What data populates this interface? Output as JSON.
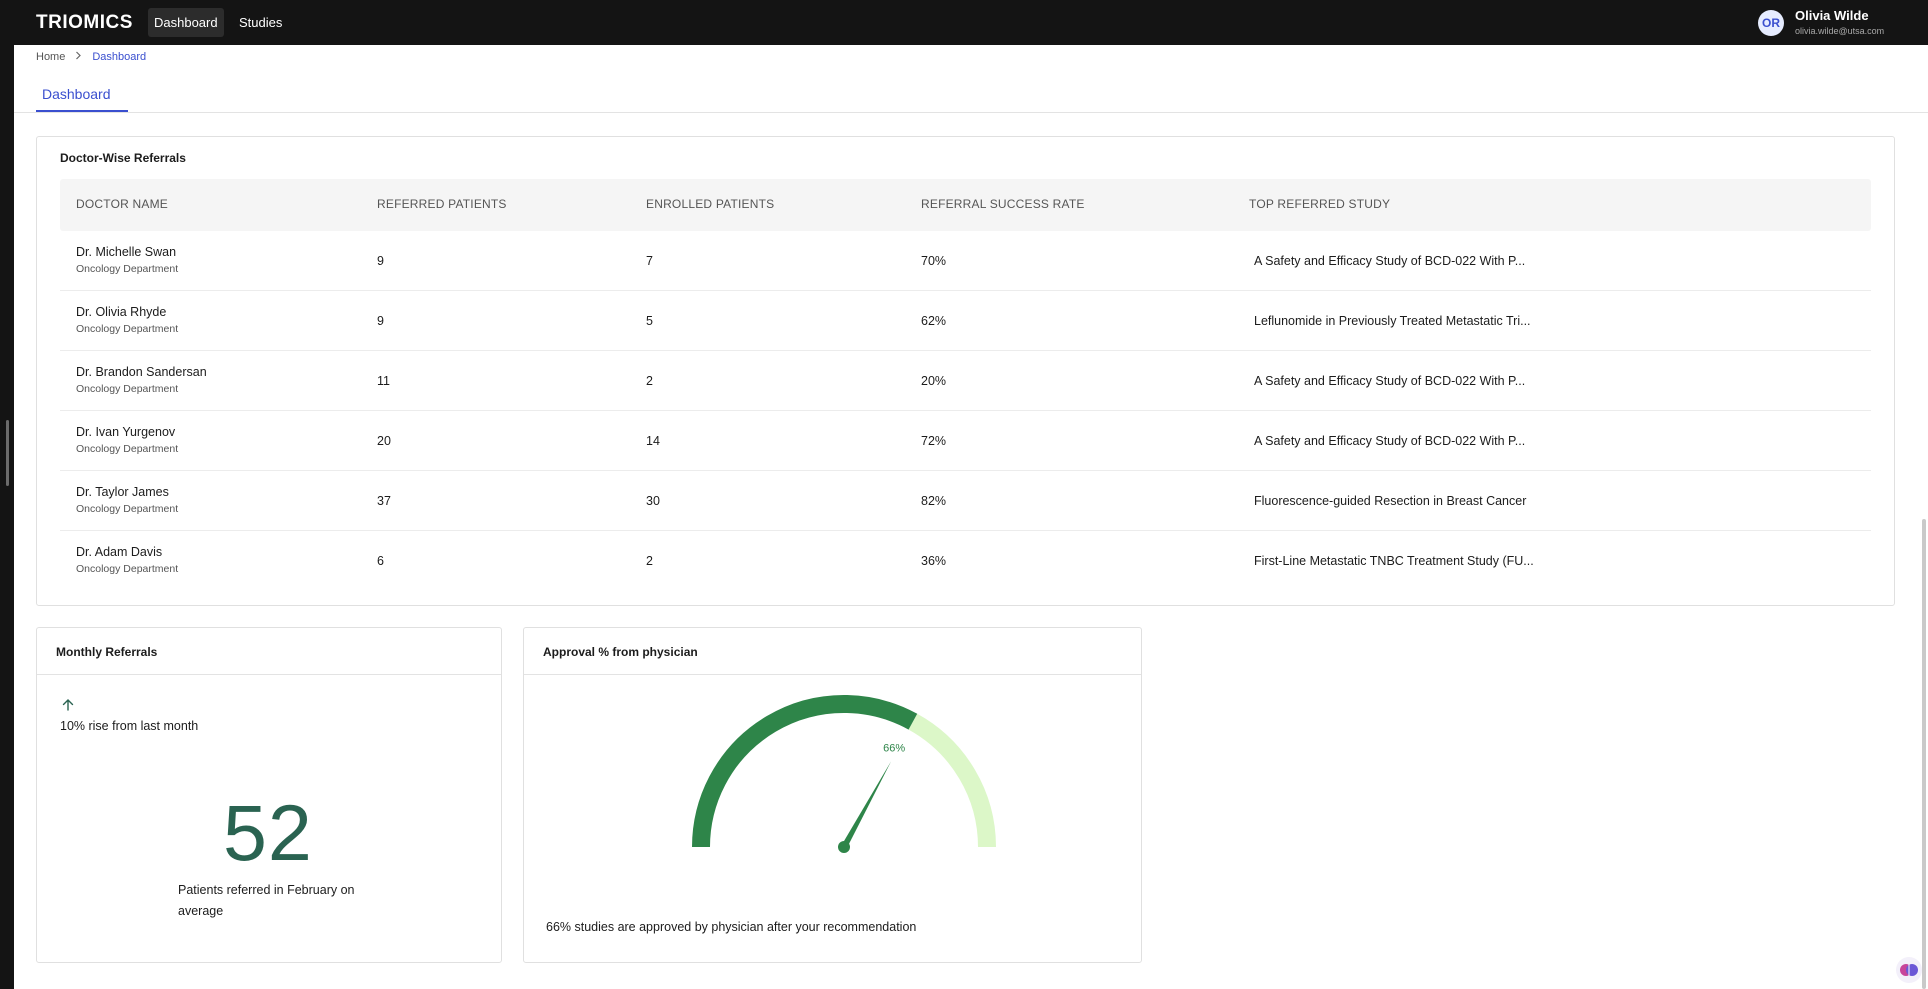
{
  "app": {
    "logo": "TRIOMICS",
    "nav": [
      {
        "label": "Dashboard",
        "active": true
      },
      {
        "label": "Studies",
        "active": false
      }
    ]
  },
  "user": {
    "initials": "OR",
    "name": "Olivia Wilde",
    "email": "olivia.wilde@utsa.com"
  },
  "breadcrumb": {
    "home": "Home",
    "current": "Dashboard"
  },
  "tabs": [
    {
      "label": "Dashboard",
      "active": true
    }
  ],
  "referrals_table": {
    "title": "Doctor-Wise Referrals",
    "columns": [
      "DOCTOR NAME",
      "REFERRED PATIENTS",
      "ENROLLED PATIENTS",
      "REFERRAL SUCCESS RATE",
      "TOP REFERRED STUDY"
    ],
    "rows": [
      {
        "name": "Dr. Michelle Swan",
        "dept": "Oncology Department",
        "referred": "9",
        "enrolled": "7",
        "rate": "70%",
        "study": "A Safety and Efficacy Study of BCD-022 With P..."
      },
      {
        "name": "Dr. Olivia Rhyde",
        "dept": "Oncology Department",
        "referred": "9",
        "enrolled": "5",
        "rate": "62%",
        "study": "Leflunomide in Previously Treated Metastatic Tri..."
      },
      {
        "name": "Dr. Brandon Sandersan",
        "dept": "Oncology Department",
        "referred": "11",
        "enrolled": "2",
        "rate": "20%",
        "study": "A Safety and Efficacy Study of BCD-022 With P..."
      },
      {
        "name": "Dr. Ivan Yurgenov",
        "dept": "Oncology Department",
        "referred": "20",
        "enrolled": "14",
        "rate": "72%",
        "study": "A Safety and Efficacy Study of BCD-022 With P..."
      },
      {
        "name": "Dr. Taylor James",
        "dept": "Oncology Department",
        "referred": "37",
        "enrolled": "30",
        "rate": "82%",
        "study": "Fluorescence-guided Resection in Breast Cancer"
      },
      {
        "name": "Dr. Adam Davis",
        "dept": "Oncology Department",
        "referred": "6",
        "enrolled": "2",
        "rate": "36%",
        "study": "First-Line Metastatic TNBC Treatment Study (FU..."
      }
    ]
  },
  "monthly_referrals": {
    "title": "Monthly Referrals",
    "trend_icon": "arrow-up-icon",
    "rise_text": "10% rise from last month",
    "value": "52",
    "caption": "Patients referred in February on average"
  },
  "approval": {
    "title": "Approval % from physician",
    "value_label": "66%",
    "value": 0.66,
    "caption": "66% studies are approved by physician after your recommendation",
    "colors": {
      "filled": "#2e8549",
      "remaining": "#dcf7c8",
      "needle": "#2e8549"
    }
  },
  "colors": {
    "accent": "#3a4fcf",
    "topbar": "#141414",
    "number": "#2a6351"
  }
}
